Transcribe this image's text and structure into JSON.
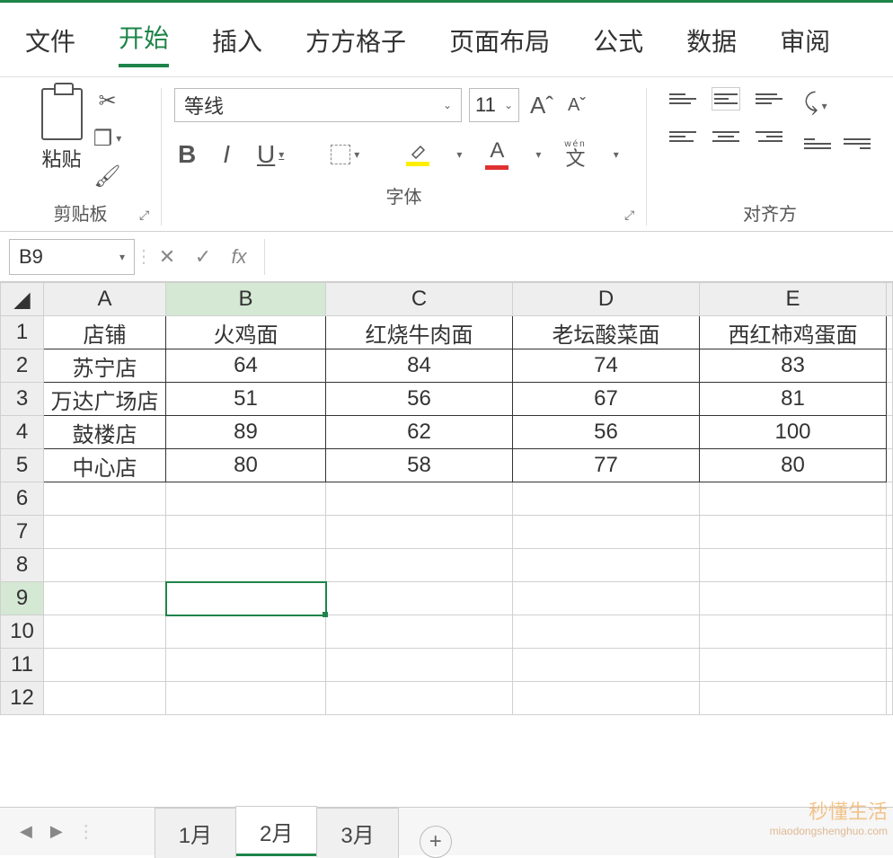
{
  "menu": {
    "tabs": [
      "文件",
      "开始",
      "插入",
      "方方格子",
      "页面布局",
      "公式",
      "数据",
      "审阅"
    ],
    "active_index": 1
  },
  "ribbon": {
    "clipboard": {
      "paste_label": "粘贴",
      "group_label": "剪贴板"
    },
    "font": {
      "name": "等线",
      "size": "11",
      "group_label": "字体",
      "bold": "B",
      "italic": "I",
      "underline": "U",
      "a_text": "A",
      "wen": "文",
      "wen_sub": "wén"
    },
    "align": {
      "group_label": "对齐方"
    }
  },
  "namebox": {
    "value": "B9"
  },
  "formula_bar": {
    "fx": "fx",
    "value": ""
  },
  "columns": [
    "A",
    "B",
    "C",
    "D",
    "E"
  ],
  "rows": [
    "1",
    "2",
    "3",
    "4",
    "5",
    "6",
    "7",
    "8",
    "9",
    "10",
    "11",
    "12"
  ],
  "selected": {
    "col": "B",
    "row": "9"
  },
  "data": {
    "r1": [
      "店铺",
      "火鸡面",
      "红烧牛肉面",
      "老坛酸菜面",
      "西红柿鸡蛋面"
    ],
    "r2": [
      "苏宁店",
      "64",
      "84",
      "74",
      "83"
    ],
    "r3": [
      "万达广场店",
      "51",
      "56",
      "67",
      "81"
    ],
    "r4": [
      "鼓楼店",
      "89",
      "62",
      "56",
      "100"
    ],
    "r5": [
      "中心店",
      "80",
      "58",
      "77",
      "80"
    ]
  },
  "sheets": {
    "tabs": [
      "1月",
      "2月",
      "3月"
    ],
    "active_index": 1
  },
  "watermark": {
    "text": "秒懂生活",
    "sub": "miaodongshenghuo.com"
  }
}
